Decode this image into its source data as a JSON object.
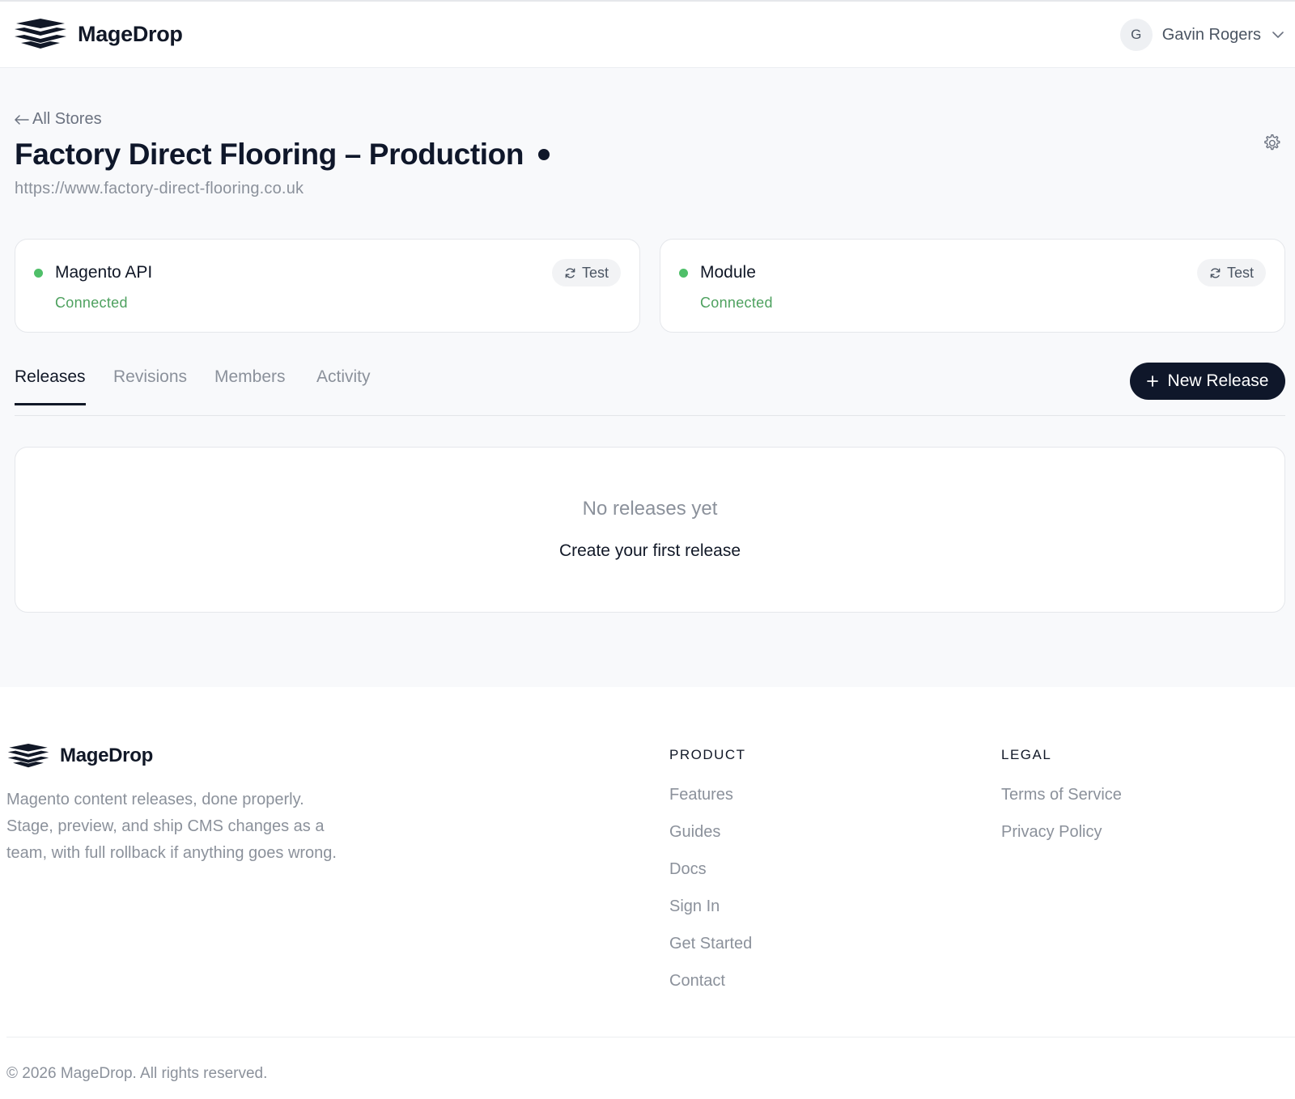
{
  "brand": {
    "name": "MageDrop"
  },
  "header": {
    "user": {
      "initial": "G",
      "name": "Gavin Rogers"
    }
  },
  "store": {
    "back_label": "All Stores",
    "title": "Factory Direct Flooring – Production",
    "url": "https://www.factory-direct-flooring.co.uk"
  },
  "connections": [
    {
      "title": "Magento API",
      "status": "Connected",
      "test_label": "Test"
    },
    {
      "title": "Module",
      "status": "Connected",
      "test_label": "Test"
    }
  ],
  "tabs": [
    {
      "label": "Releases",
      "active": true
    },
    {
      "label": "Revisions",
      "active": false
    },
    {
      "label": "Members",
      "active": false
    },
    {
      "label": "Activity",
      "active": false
    }
  ],
  "new_release_label": "New Release",
  "empty_state": {
    "title": "No releases yet",
    "subtitle": "Create your first release"
  },
  "footer": {
    "tagline": [
      "Magento content releases, done properly.",
      "Stage, preview, and ship CMS changes as a",
      "team, with full rollback if anything goes wrong."
    ],
    "product": {
      "heading": "PRODUCT",
      "links": [
        "Features",
        "Guides",
        "Docs",
        "Sign In",
        "Get Started",
        "Contact"
      ]
    },
    "legal": {
      "heading": "LEGAL",
      "links": [
        "Terms of Service",
        "Privacy Policy"
      ]
    },
    "copyright": "© 2026 MageDrop. All rights reserved."
  },
  "colors": {
    "primary": "#0f172a",
    "success": "#4fbf69",
    "success_text": "#4ea15f",
    "muted": "#8b919b",
    "background": "#f8f9fb"
  }
}
